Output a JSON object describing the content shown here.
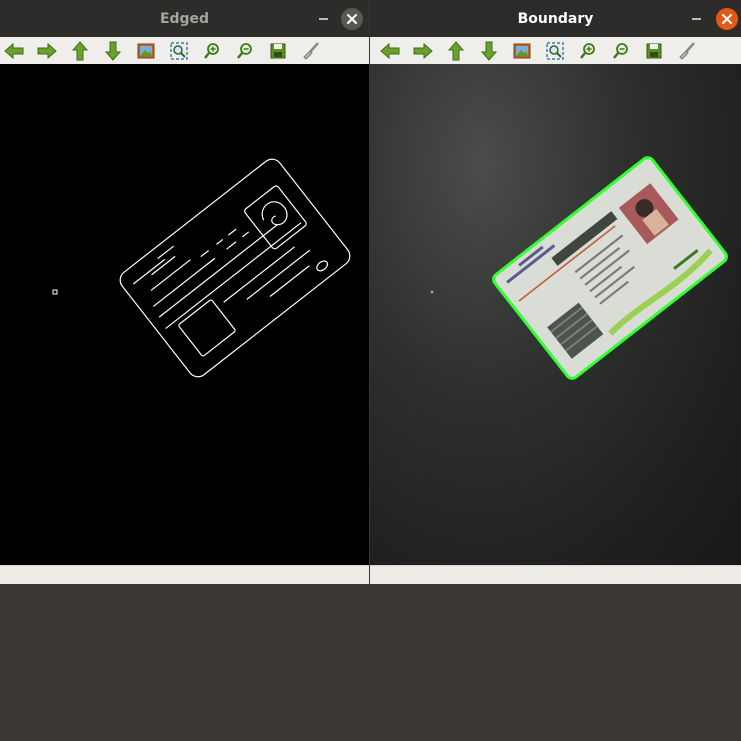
{
  "desktop": {
    "background": "#3a3733"
  },
  "windows": [
    {
      "title": "Edged",
      "active": false,
      "image": {
        "content": "canny-edge-map-of-card"
      },
      "toolbar": [
        "arrow-left-icon",
        "arrow-right-icon",
        "arrow-up-icon",
        "arrow-down-icon",
        "image-icon",
        "zoom-fit-icon",
        "zoom-in-icon",
        "zoom-out-icon",
        "save-icon",
        "brush-icon"
      ]
    },
    {
      "title": "Boundary",
      "active": true,
      "image": {
        "content": "photo-of-card-with-green-contour"
      },
      "toolbar": [
        "arrow-left-icon",
        "arrow-right-icon",
        "arrow-up-icon",
        "arrow-down-icon",
        "image-icon",
        "zoom-fit-icon",
        "zoom-in-icon",
        "zoom-out-icon",
        "save-icon",
        "brush-icon"
      ]
    }
  ],
  "colors": {
    "close_active": "#e25b16",
    "close_inactive": "#5a5854",
    "toolbar_green": "#6aa12c",
    "contour": "#33ff33"
  }
}
